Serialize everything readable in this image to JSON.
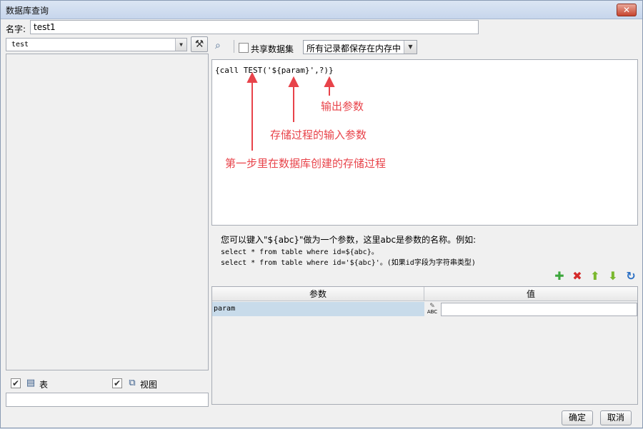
{
  "window": {
    "title": "数据库查询",
    "close_label": "✕"
  },
  "name_field": {
    "label": "名字:",
    "value": "test1"
  },
  "datasource": {
    "selected": "test",
    "arrow": "▼",
    "tool_icon": "⚒"
  },
  "left_panel": {
    "table_label": "表",
    "view_label": "视图",
    "table_checked": "✔",
    "view_checked": "✔"
  },
  "toolbar": {
    "share_label": "共享数据集",
    "mode_selected": "所有记录都保存在内存中",
    "mode_arrow": "▼"
  },
  "sql": {
    "text": "{call TEST('${param}',?)}"
  },
  "annotations": [
    "输出参数",
    "存储过程的输入参数",
    "第一步里在数据库创建的存储过程"
  ],
  "hint": {
    "line1": "您可以键入\"${abc}\"做为一个参数，这里abc是参数的名称。例如:",
    "line2": "select * from table where id=${abc}。",
    "line3": "select * from table where id='${abc}'。(如果id字段为字符串类型)"
  },
  "param_actions": {
    "add": "✚",
    "remove": "✖",
    "up": "⬆",
    "down": "⬇",
    "refresh": "↻"
  },
  "colors": {
    "add": "#3ca63c",
    "remove": "#d42a2a",
    "up": "#7ab82e",
    "down": "#7ab82e",
    "refresh": "#2a6fc4",
    "annotation": "#e8434a"
  },
  "param_table": {
    "headers": [
      "参数",
      "值"
    ],
    "rows": [
      {
        "name": "param",
        "type": "ABC",
        "value": ""
      }
    ]
  },
  "footer": {
    "ok": "确定",
    "cancel": "取消"
  }
}
